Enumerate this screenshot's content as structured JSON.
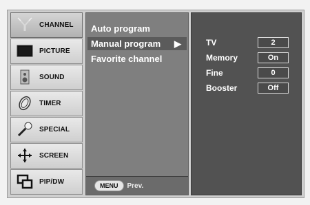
{
  "categories": [
    {
      "label": "CHANNEL",
      "icon": "antenna-icon",
      "active": true
    },
    {
      "label": "PICTURE",
      "icon": "monitor-icon",
      "active": false
    },
    {
      "label": "SOUND",
      "icon": "speaker-icon",
      "active": false
    },
    {
      "label": "TIMER",
      "icon": "clock-icon",
      "active": false
    },
    {
      "label": "SPECIAL",
      "icon": "wrench-icon",
      "active": false
    },
    {
      "label": "SCREEN",
      "icon": "move-arrows-icon",
      "active": false
    },
    {
      "label": "PIP/DW",
      "icon": "pip-windows-icon",
      "active": false
    }
  ],
  "submenu": {
    "items": [
      {
        "label": "Auto program"
      },
      {
        "label": "Manual program",
        "selected": true,
        "arrow": "▶"
      },
      {
        "label": "Favorite channel"
      }
    ],
    "footer": {
      "button_label": "MENU",
      "action_label": "Prev."
    }
  },
  "settings": [
    {
      "label": "TV",
      "value": "2"
    },
    {
      "label": "Memory",
      "value": "On"
    },
    {
      "label": "Fine",
      "value": "0"
    },
    {
      "label": "Booster",
      "value": "Off"
    }
  ]
}
